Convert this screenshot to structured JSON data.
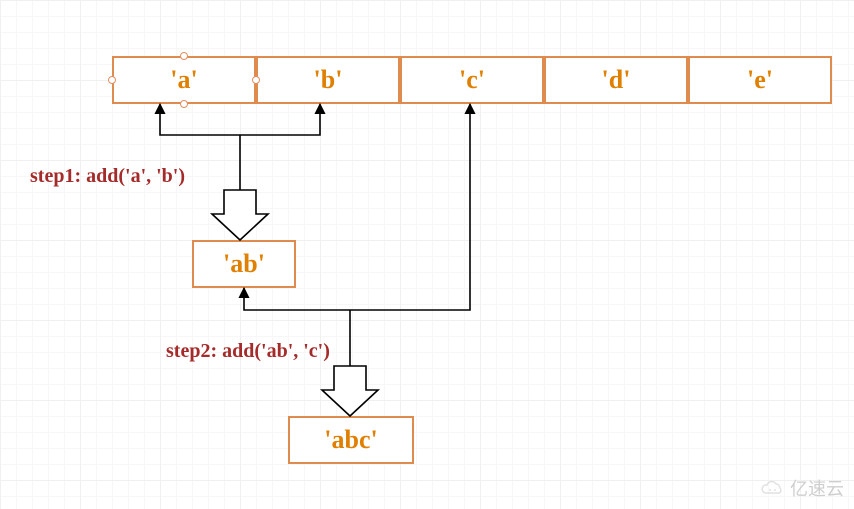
{
  "array": {
    "cells": [
      "'a'",
      "'b'",
      "'c'",
      "'d'",
      "'e'"
    ]
  },
  "steps": {
    "step1_label": "step1: add('a', 'b')",
    "step2_label": "step2: add('ab', 'c')",
    "result1": "'ab'",
    "result2": "'abc'"
  },
  "watermark": "亿速云"
}
